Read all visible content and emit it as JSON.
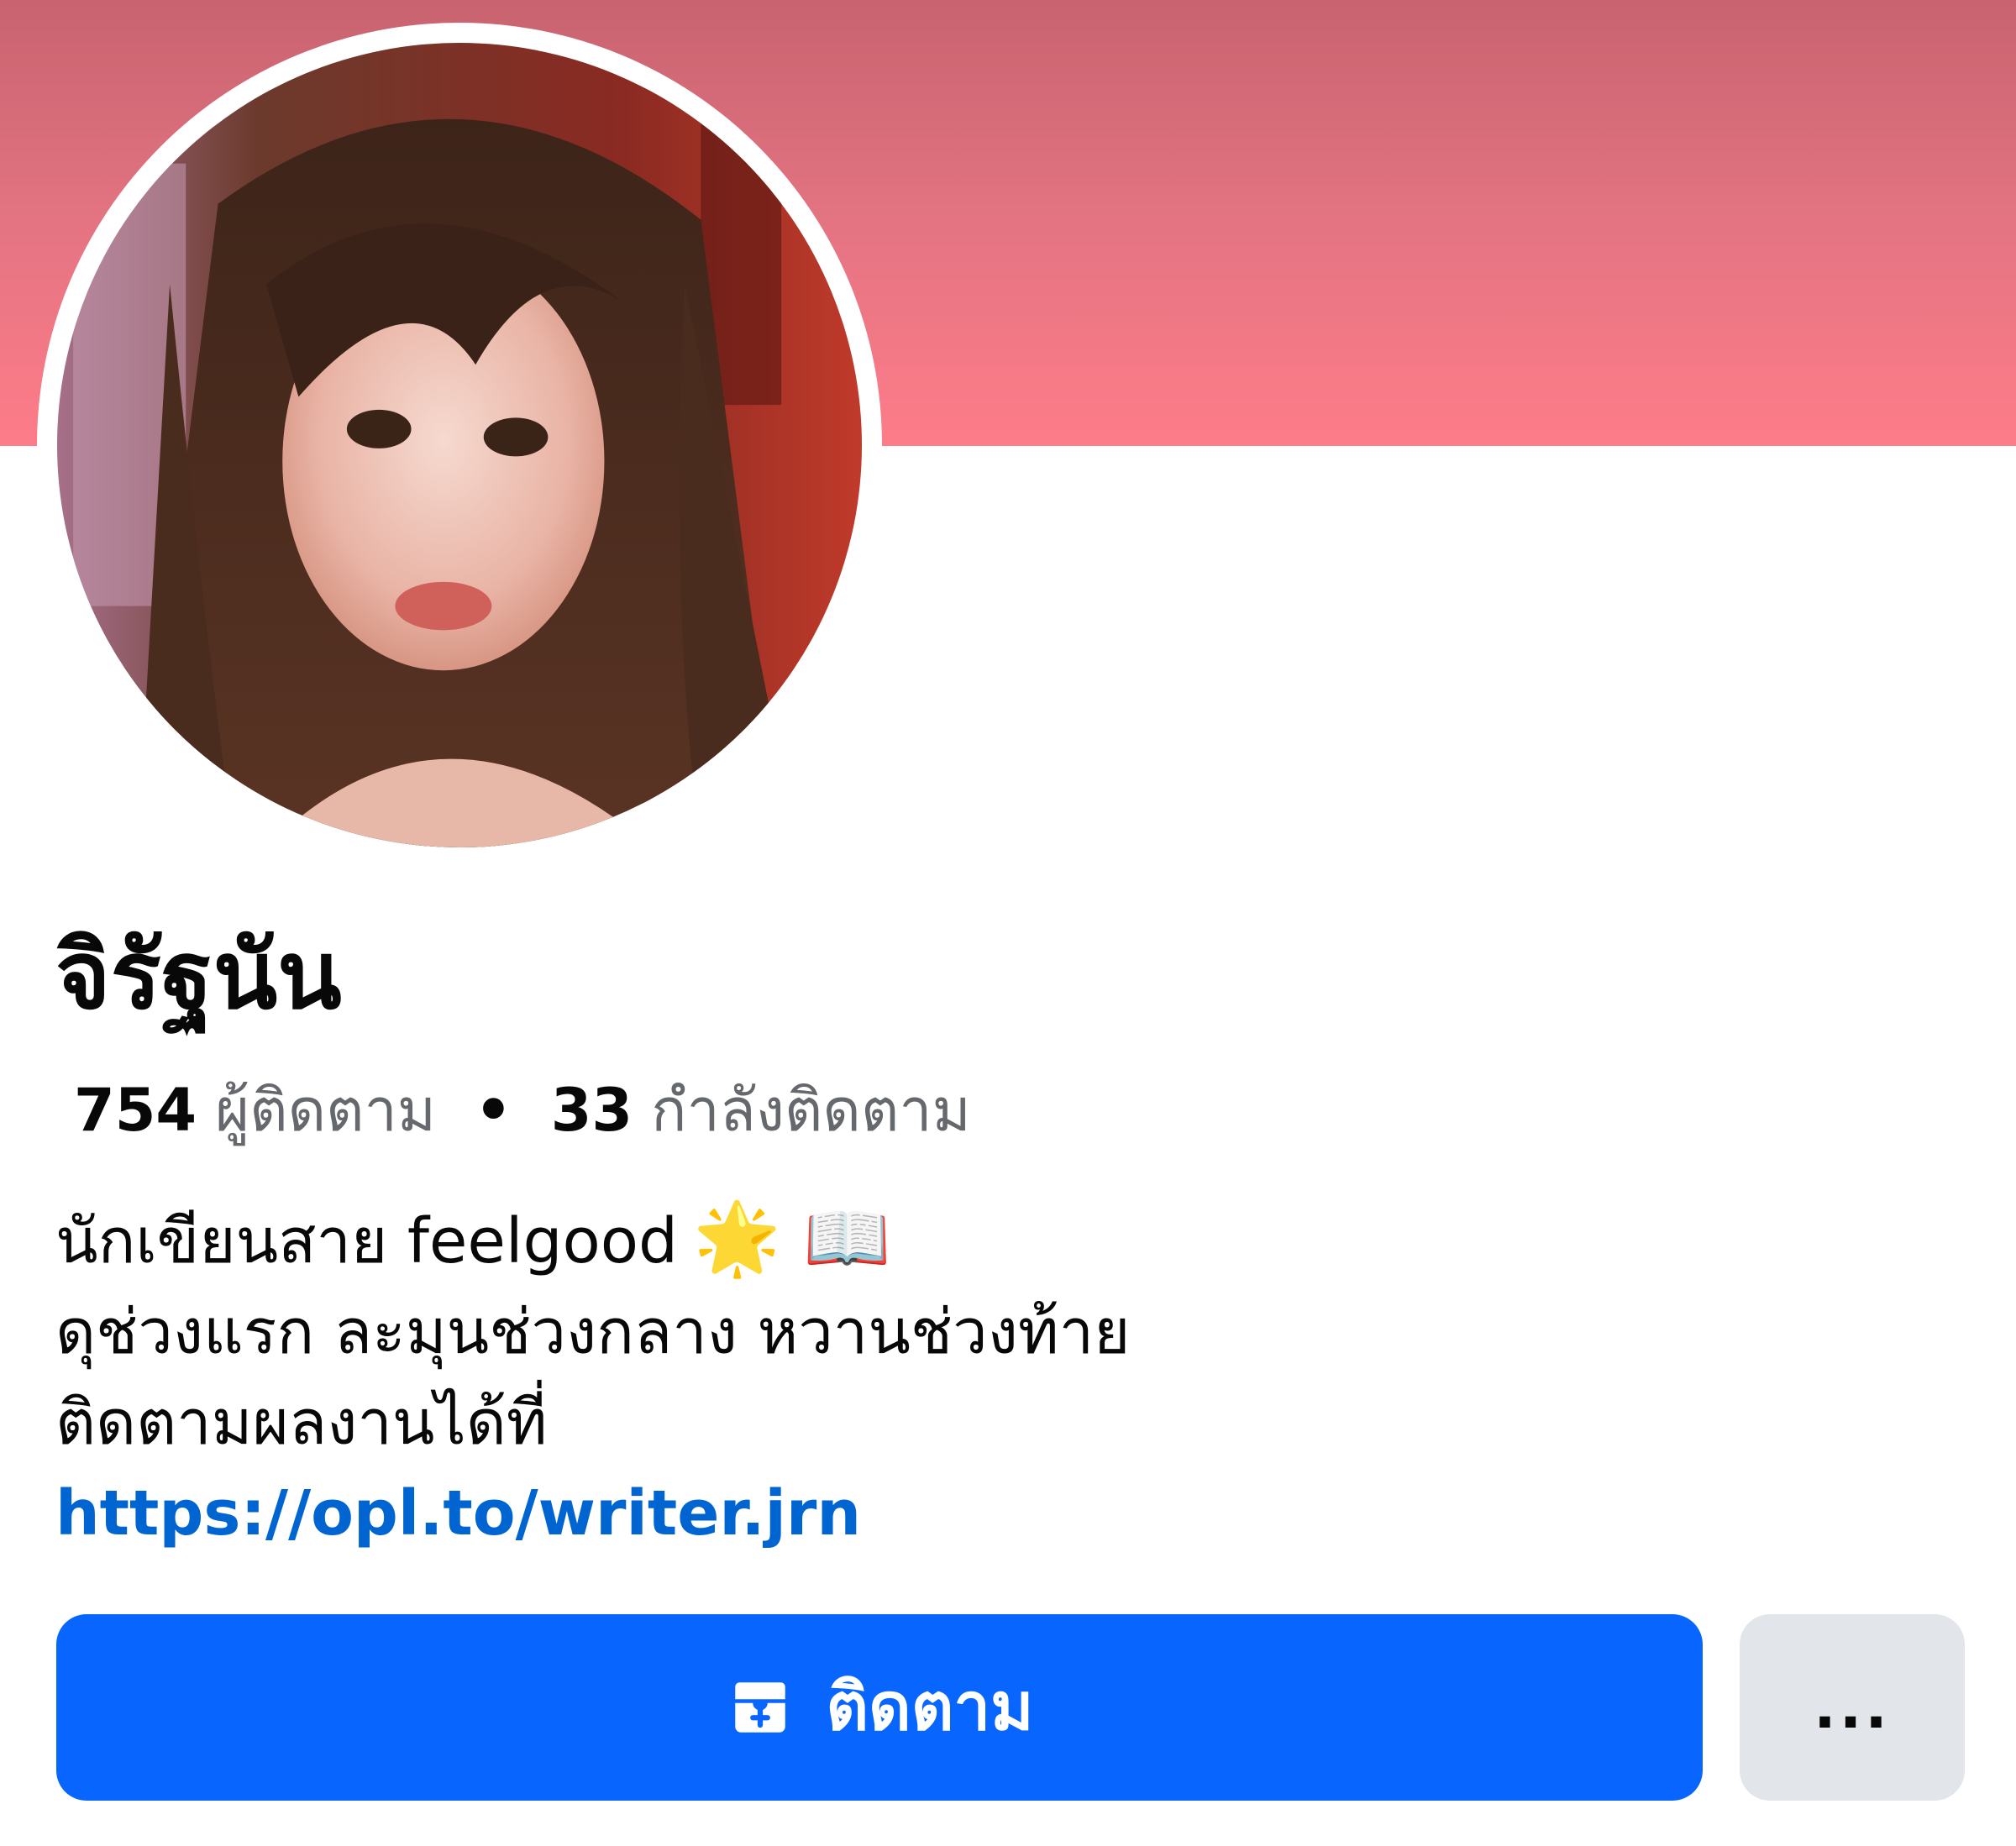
{
  "profile": {
    "name": "จิรัฐนัน",
    "avatar_alt": "profile-illustration"
  },
  "stats": {
    "followers_count": "754",
    "followers_label": "ผู้ติดตาม",
    "separator": "•",
    "following_count": "33",
    "following_label": "กำลังติดตาม"
  },
  "bio": {
    "line1_text": "นักเขียนสาย feelgood",
    "line1_emoji": "🌟 📖",
    "line2": "ดุช่วงแรก ละมุนช่วงกลาง หวานช่วงท้าย",
    "line3": "ติดตามผลงานได้ที่",
    "link": "https://opl.to/writer.jrn"
  },
  "actions": {
    "follow_label": "ติดตาม",
    "follow_icon": "add-to-inbox-icon",
    "more_label": "..."
  },
  "colors": {
    "cover_top": "#c8636f",
    "cover_bottom": "#fe7c89",
    "follow_button": "#0866ff",
    "more_button": "#e2e5e9",
    "link": "#0064d1",
    "secondary_text": "#65686c"
  }
}
